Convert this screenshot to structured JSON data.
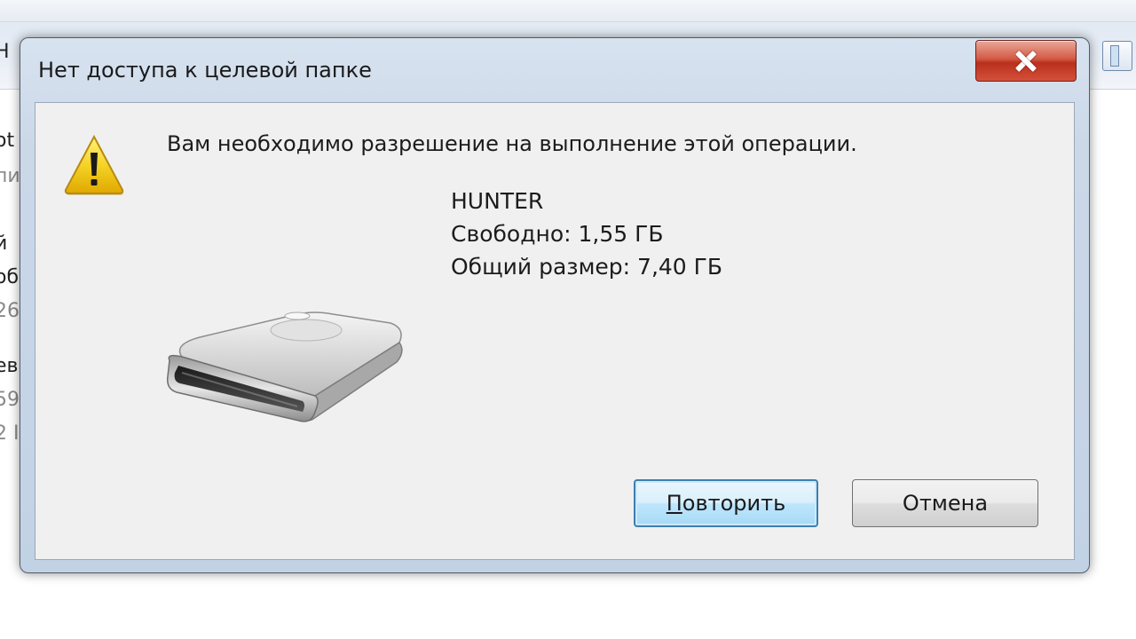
{
  "dialog": {
    "title": "Нет доступа к целевой папке",
    "close_tooltip": "Закрыть",
    "message": "Вам необходимо разрешение на выполнение этой операции.",
    "drive": {
      "name": "HUNTER",
      "free": "Свободно: 1,55 ГБ",
      "total": "Общий размер: 7,40 ГБ"
    },
    "buttons": {
      "retry_accel": "П",
      "retry_rest": "овторить",
      "cancel": "Отмена"
    }
  },
  "background": {
    "left_fragments": [
      "Н",
      "ot",
      "пи",
      "й",
      "об",
      "26",
      "ев",
      "59",
      "2 I"
    ]
  },
  "icons": {
    "warning": "warning-icon",
    "drive": "removable-drive-icon",
    "close": "close-icon"
  },
  "colors": {
    "close_button": "#c7402b",
    "retry_border": "#3c7fb1",
    "warning_yellow": "#f5d327"
  }
}
